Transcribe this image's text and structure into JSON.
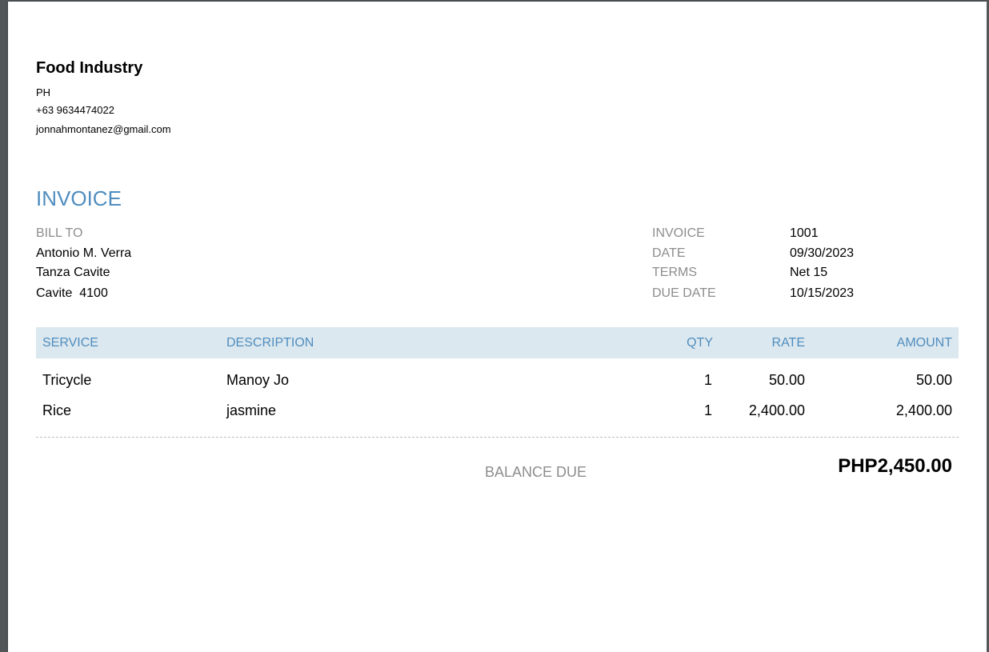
{
  "company": {
    "name": "Food Industry",
    "country": "PH",
    "phone": "+63 9634474022",
    "email": "jonnahmontanez@gmail.com"
  },
  "title": "INVOICE",
  "bill_to": {
    "label": "BILL TO",
    "name": "Antonio M. Verra",
    "address_line1": "Tanza Cavite",
    "address_line2": "Cavite  4100"
  },
  "meta": [
    {
      "label": "INVOICE",
      "value": "1001"
    },
    {
      "label": "DATE",
      "value": "09/30/2023"
    },
    {
      "label": "TERMS",
      "value": "Net 15"
    },
    {
      "label": "DUE DATE",
      "value": "10/15/2023"
    }
  ],
  "table": {
    "headers": {
      "service": "SERVICE",
      "description": "DESCRIPTION",
      "qty": "QTY",
      "rate": "RATE",
      "amount": "AMOUNT"
    },
    "rows": [
      {
        "service": "Tricycle",
        "description": "Manoy Jo",
        "qty": "1",
        "rate": "50.00",
        "amount": "50.00"
      },
      {
        "service": "Rice",
        "description": "jasmine",
        "qty": "1",
        "rate": "2,400.00",
        "amount": "2,400.00"
      }
    ]
  },
  "balance": {
    "label": "BALANCE DUE",
    "value": "PHP2,450.00"
  },
  "colors": {
    "accent": "#4f8dbf",
    "header_bg": "#dce8ef",
    "label_grey": "#8d8d8d"
  }
}
